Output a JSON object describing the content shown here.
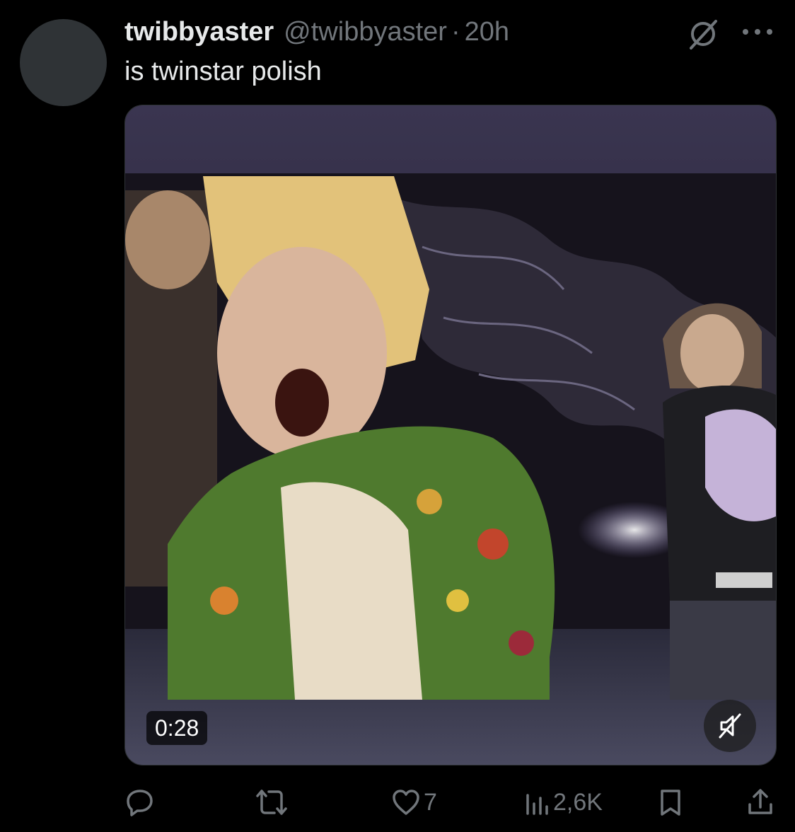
{
  "post": {
    "display_name": "twibbyaster",
    "handle": "@twibbyaster",
    "separator": "·",
    "time": "20h",
    "text": "is twinstar polish"
  },
  "media": {
    "duration": "0:28"
  },
  "actions": {
    "reply_count": "",
    "repost_count": "",
    "like_count": "7",
    "views_count": "2,6K"
  },
  "colors": {
    "background": "#000000",
    "text_primary": "#e7e9ea",
    "text_secondary": "#71767b",
    "avatar": "#2f3336"
  },
  "icons": {
    "grok": "grok-icon",
    "more": "more-icon",
    "mute": "muted-speaker-icon",
    "reply": "reply-icon",
    "repost": "repost-icon",
    "like": "heart-icon",
    "views": "views-icon",
    "bookmark": "bookmark-icon",
    "share": "share-icon"
  }
}
